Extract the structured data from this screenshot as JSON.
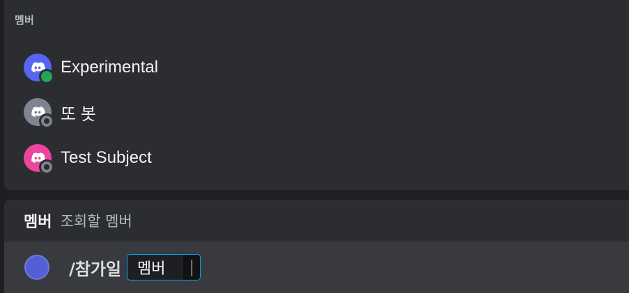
{
  "autocomplete": {
    "header": "멤버",
    "members": [
      {
        "name": "Experimental",
        "avatar_color": "#5865f2",
        "status": "online",
        "icon": "discord-logo-icon"
      },
      {
        "name": "또 봇",
        "avatar_color": "#80848e",
        "status": "offline",
        "icon": "discord-logo-icon"
      },
      {
        "name": "Test Subject",
        "avatar_color": "#eb459e",
        "status": "offline",
        "icon": "discord-logo-icon"
      }
    ]
  },
  "option": {
    "name": "멤버",
    "description": "조회할 멤버"
  },
  "composer": {
    "command": "/참가일",
    "param_label": "멤버",
    "param_value": ""
  },
  "colors": {
    "popup_bg": "#2b2d31",
    "input_bg": "#383a40",
    "accent_focus": "#00a8fc",
    "online": "#23a55a",
    "offline": "#80848e"
  }
}
